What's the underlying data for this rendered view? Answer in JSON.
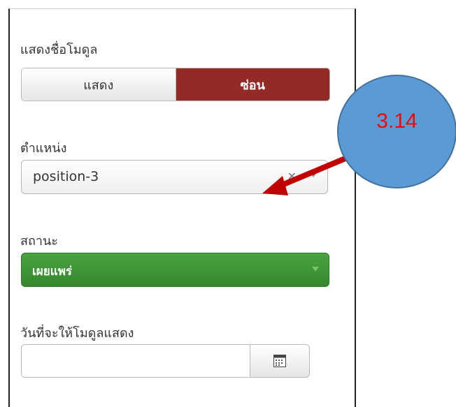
{
  "show_module_title": {
    "label": "แสดงชื่อโมดูล",
    "options": [
      "แสดง",
      "ซ่อน"
    ],
    "selected": "ซ่อน"
  },
  "position": {
    "label": "ตำแหน่ง",
    "value": "position-3"
  },
  "status": {
    "label": "สถานะ",
    "value": "เผยแพร่",
    "color": "#3c9a35"
  },
  "publish_up": {
    "label": "วันที่จะให้โมดูลแสดง",
    "value": ""
  },
  "annotation": {
    "text": "3.14",
    "circle_color": "#5b9bd5",
    "arrow_color": "#c00000",
    "text_color": "#ff0000"
  },
  "icons": {
    "clear": "close-icon",
    "dropdown": "chevron-down-icon",
    "calendar": "calendar-icon"
  }
}
